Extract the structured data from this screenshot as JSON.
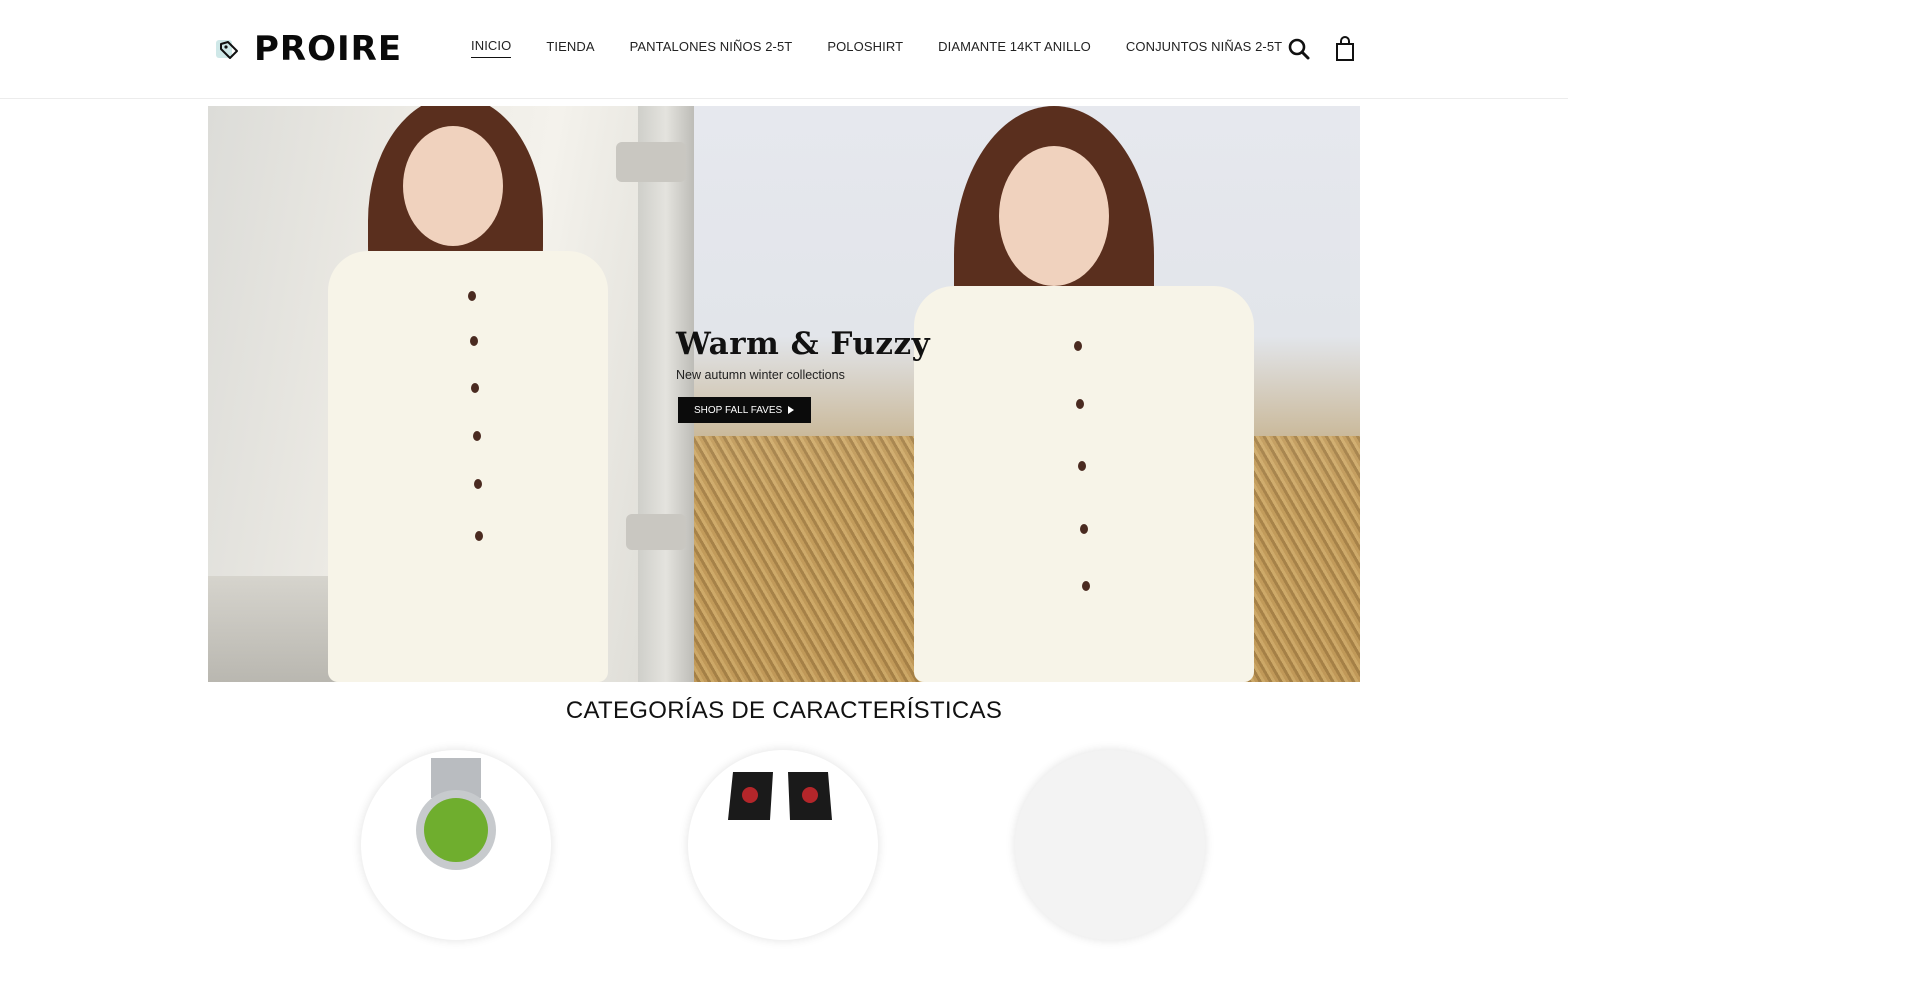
{
  "header": {
    "logo_text": "PROIRE",
    "logo_icon": "tag-icon",
    "nav": [
      {
        "label": "INICIO",
        "active": true
      },
      {
        "label": "TIENDA",
        "active": false
      },
      {
        "label": "PANTALONES NIÑOS 2-5T",
        "active": false
      },
      {
        "label": "POLOSHIRT",
        "active": false
      },
      {
        "label": "DIAMANTE 14KT ANILLO",
        "active": false
      },
      {
        "label": "CONJUNTOS NIÑAS 2-5T",
        "active": false
      }
    ],
    "search_icon": "search-icon",
    "cart_icon": "shopping-bag-icon"
  },
  "hero": {
    "title": "Warm & Fuzzy",
    "subtitle": "New autumn winter collections",
    "cta_label": "SHOP FALL FAVES",
    "cta_icon": "play-triangle-icon"
  },
  "categories": {
    "title": "CATEGORÍAS DE CARACTERÍSTICAS",
    "items": [
      {
        "image": "watch"
      },
      {
        "image": "boots"
      },
      {
        "image": "blank"
      }
    ]
  },
  "colors": {
    "text": "#111111",
    "cta_bg": "#0b0b0b",
    "logo_accent": "#cfe8e8"
  }
}
